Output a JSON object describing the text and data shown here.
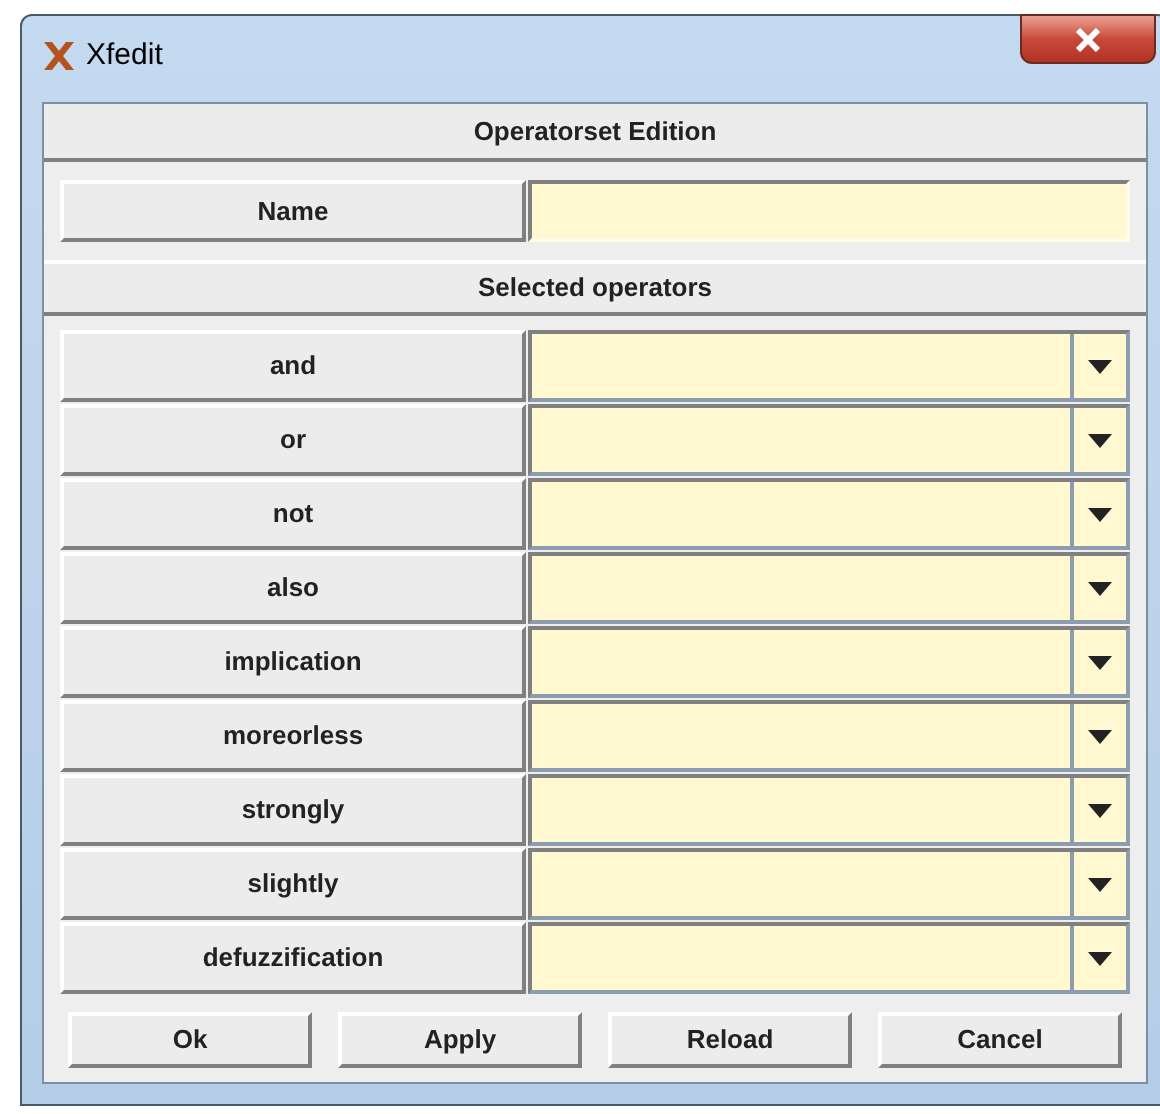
{
  "window": {
    "title": "Xfedit"
  },
  "header": "Operatorset Edition",
  "name_field": {
    "label": "Name"
  },
  "section": "Selected operators",
  "operators": [
    {
      "label": "and"
    },
    {
      "label": "or"
    },
    {
      "label": "not"
    },
    {
      "label": "also"
    },
    {
      "label": "implication"
    },
    {
      "label": "moreorless"
    },
    {
      "label": "strongly"
    },
    {
      "label": "slightly"
    },
    {
      "label": "defuzzification"
    }
  ],
  "buttons": [
    "Ok",
    "Apply",
    "Reload",
    "Cancel"
  ]
}
